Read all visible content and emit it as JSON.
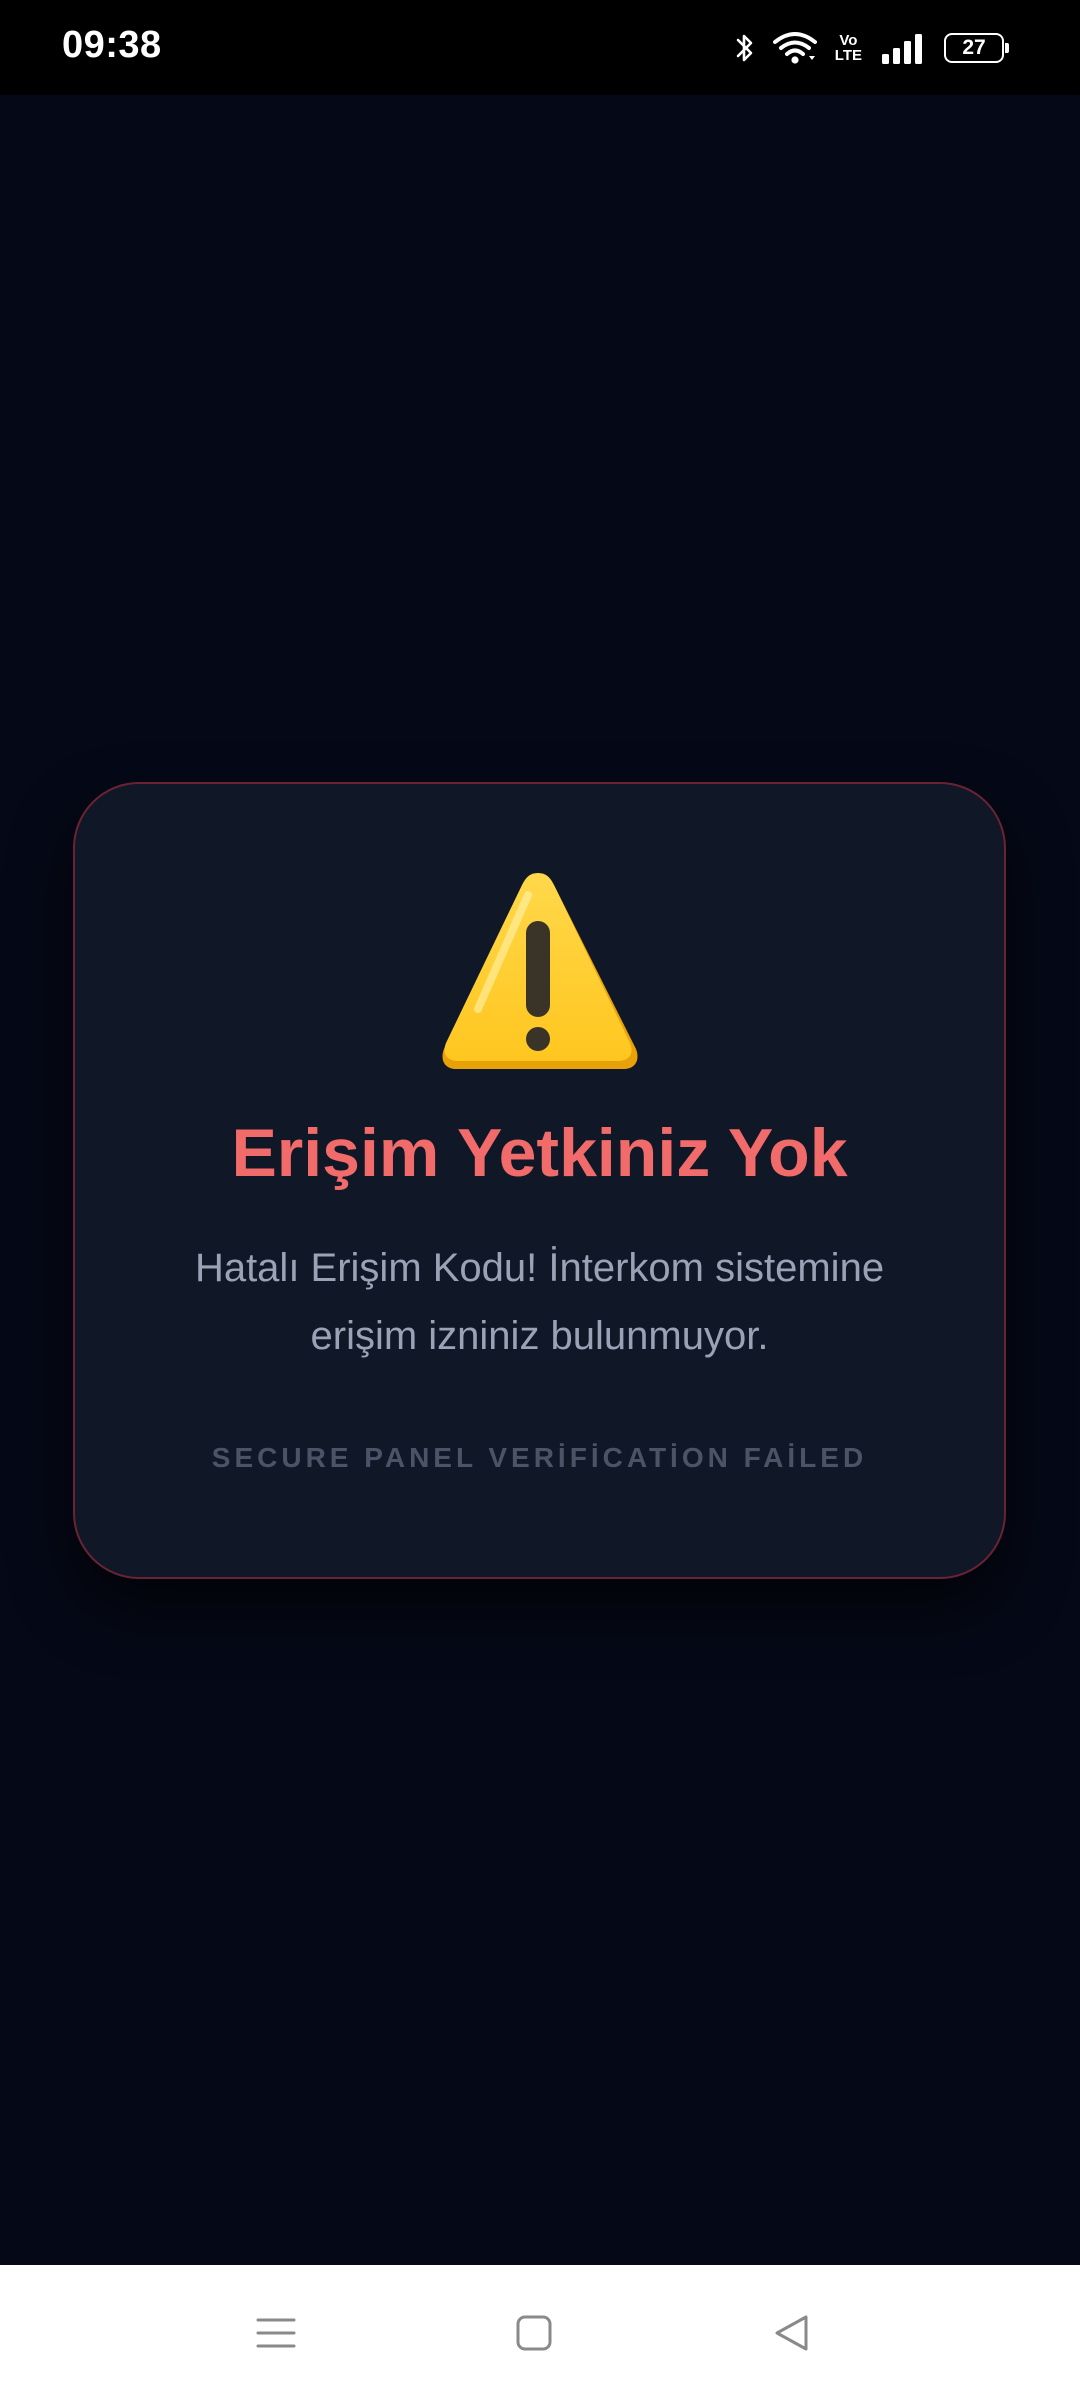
{
  "status_bar": {
    "time": "09:38",
    "battery_level": "27",
    "network_label_top": "Vo",
    "network_label_bottom": "LTE"
  },
  "card": {
    "icon": "warning-icon",
    "title": "Erişim Yetkiniz Yok",
    "message": "Hatalı Erişim Kodu! İnterkom sistemine erişim izniniz bulunmuyor.",
    "footer": "SECURE PANEL VERİFİCATİON FAİLED"
  },
  "nav_bar": {
    "buttons": [
      "menu-icon",
      "home-icon",
      "back-icon"
    ]
  },
  "colors": {
    "background": "#050816",
    "card_background": "#101727",
    "card_border": "#6b2333",
    "title": "#f26b6b",
    "message": "#9aa3b5",
    "footer": "#4b5466",
    "warning_yellow": "#ffc928"
  }
}
